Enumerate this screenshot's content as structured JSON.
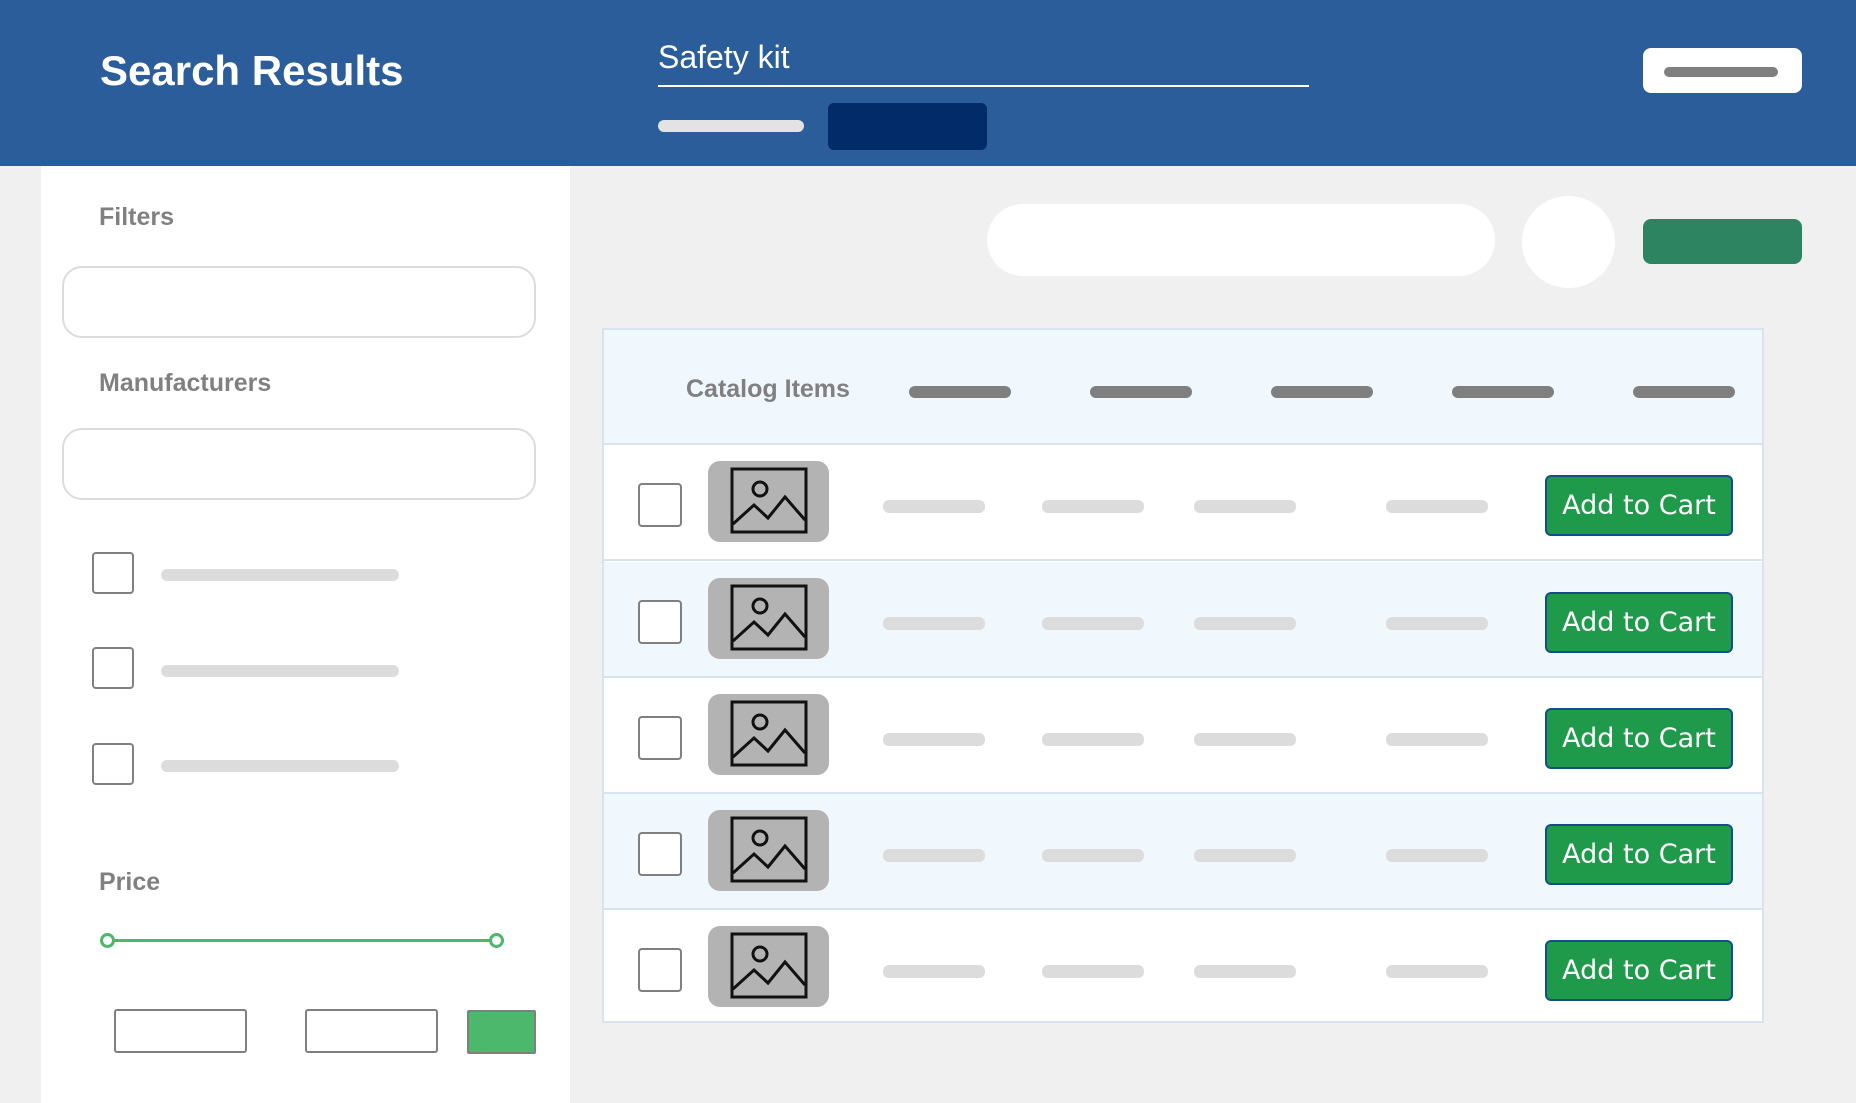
{
  "header": {
    "title": "Search Results",
    "search_value": "Safety kit"
  },
  "sidebar": {
    "filters_label": "Filters",
    "manufacturers_label": "Manufacturers",
    "price_label": "Price"
  },
  "table": {
    "header_title": "Catalog Items",
    "rows": [
      {
        "cart_label": "Add to Cart"
      },
      {
        "cart_label": "Add to Cart"
      },
      {
        "cart_label": "Add to Cart"
      },
      {
        "cart_label": "Add to Cart"
      },
      {
        "cart_label": "Add to Cart"
      }
    ]
  },
  "colors": {
    "header_bg": "#2a5d99",
    "cart_button": "#1f9a4a",
    "price_slider": "#4cb86b",
    "toolbar_button": "#2d8460"
  },
  "icons": {
    "thumbnail": "image-placeholder-icon"
  }
}
